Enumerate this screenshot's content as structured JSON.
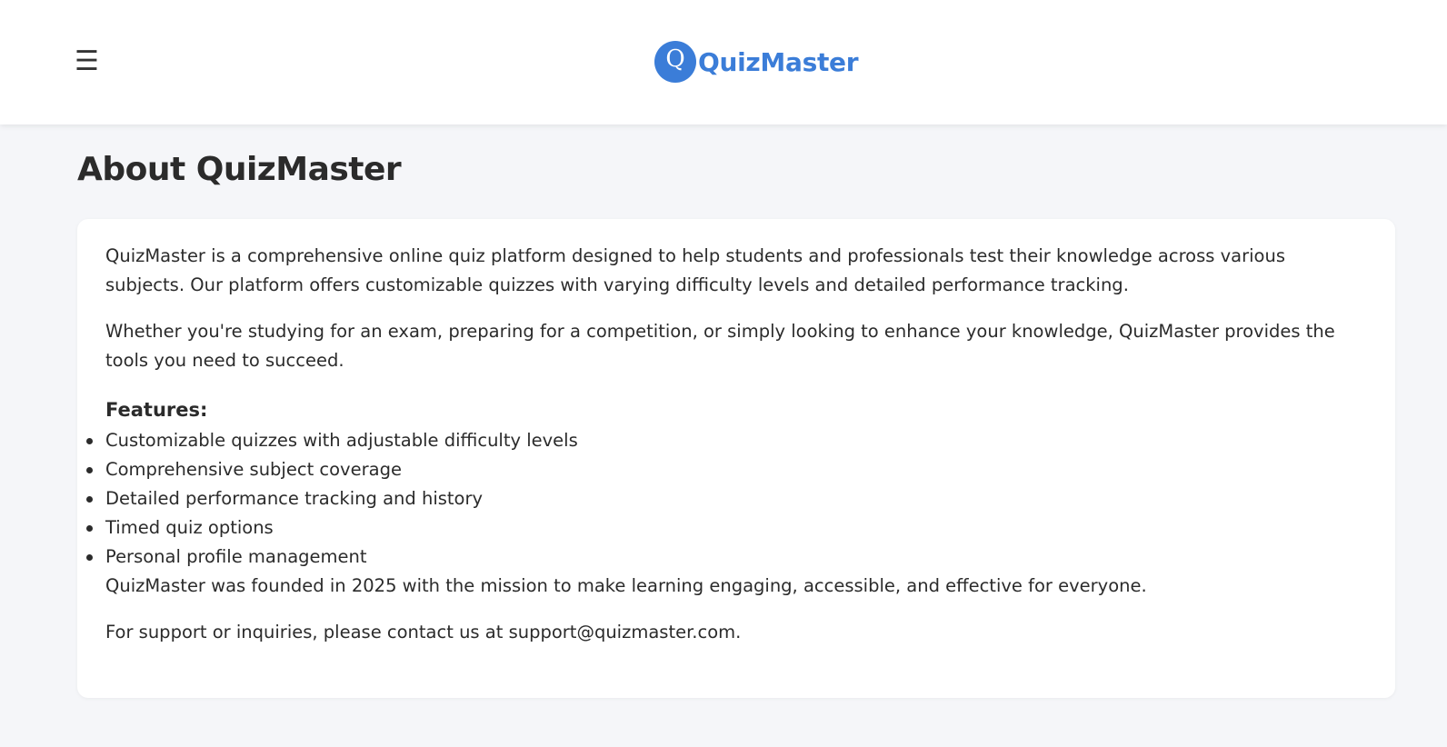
{
  "header": {
    "menu_icon": "☰",
    "logo_letter": "Q",
    "brand_name": "QuizMaster"
  },
  "colors": {
    "accent": "#3b7dd8",
    "background": "#f5f6f9",
    "text": "#2b2b2b"
  },
  "page": {
    "title": "About QuizMaster",
    "intro_paragraphs": [
      "QuizMaster is a comprehensive online quiz platform designed to help students and professionals test their knowledge across various subjects. Our platform offers customizable quizzes with varying difficulty levels and detailed performance tracking.",
      "Whether you're studying for an exam, preparing for a competition, or simply looking to enhance your knowledge, QuizMaster provides the tools you need to succeed."
    ],
    "features_heading": "Features:",
    "features": [
      "Customizable quizzes with adjustable difficulty levels",
      "Comprehensive subject coverage",
      "Detailed performance tracking and history",
      "Timed quiz options",
      "Personal profile management"
    ],
    "founded_text": "QuizMaster was founded in 2025 with the mission to make learning engaging, accessible, and effective for everyone.",
    "support_text": "For support or inquiries, please contact us at support@quizmaster.com."
  }
}
